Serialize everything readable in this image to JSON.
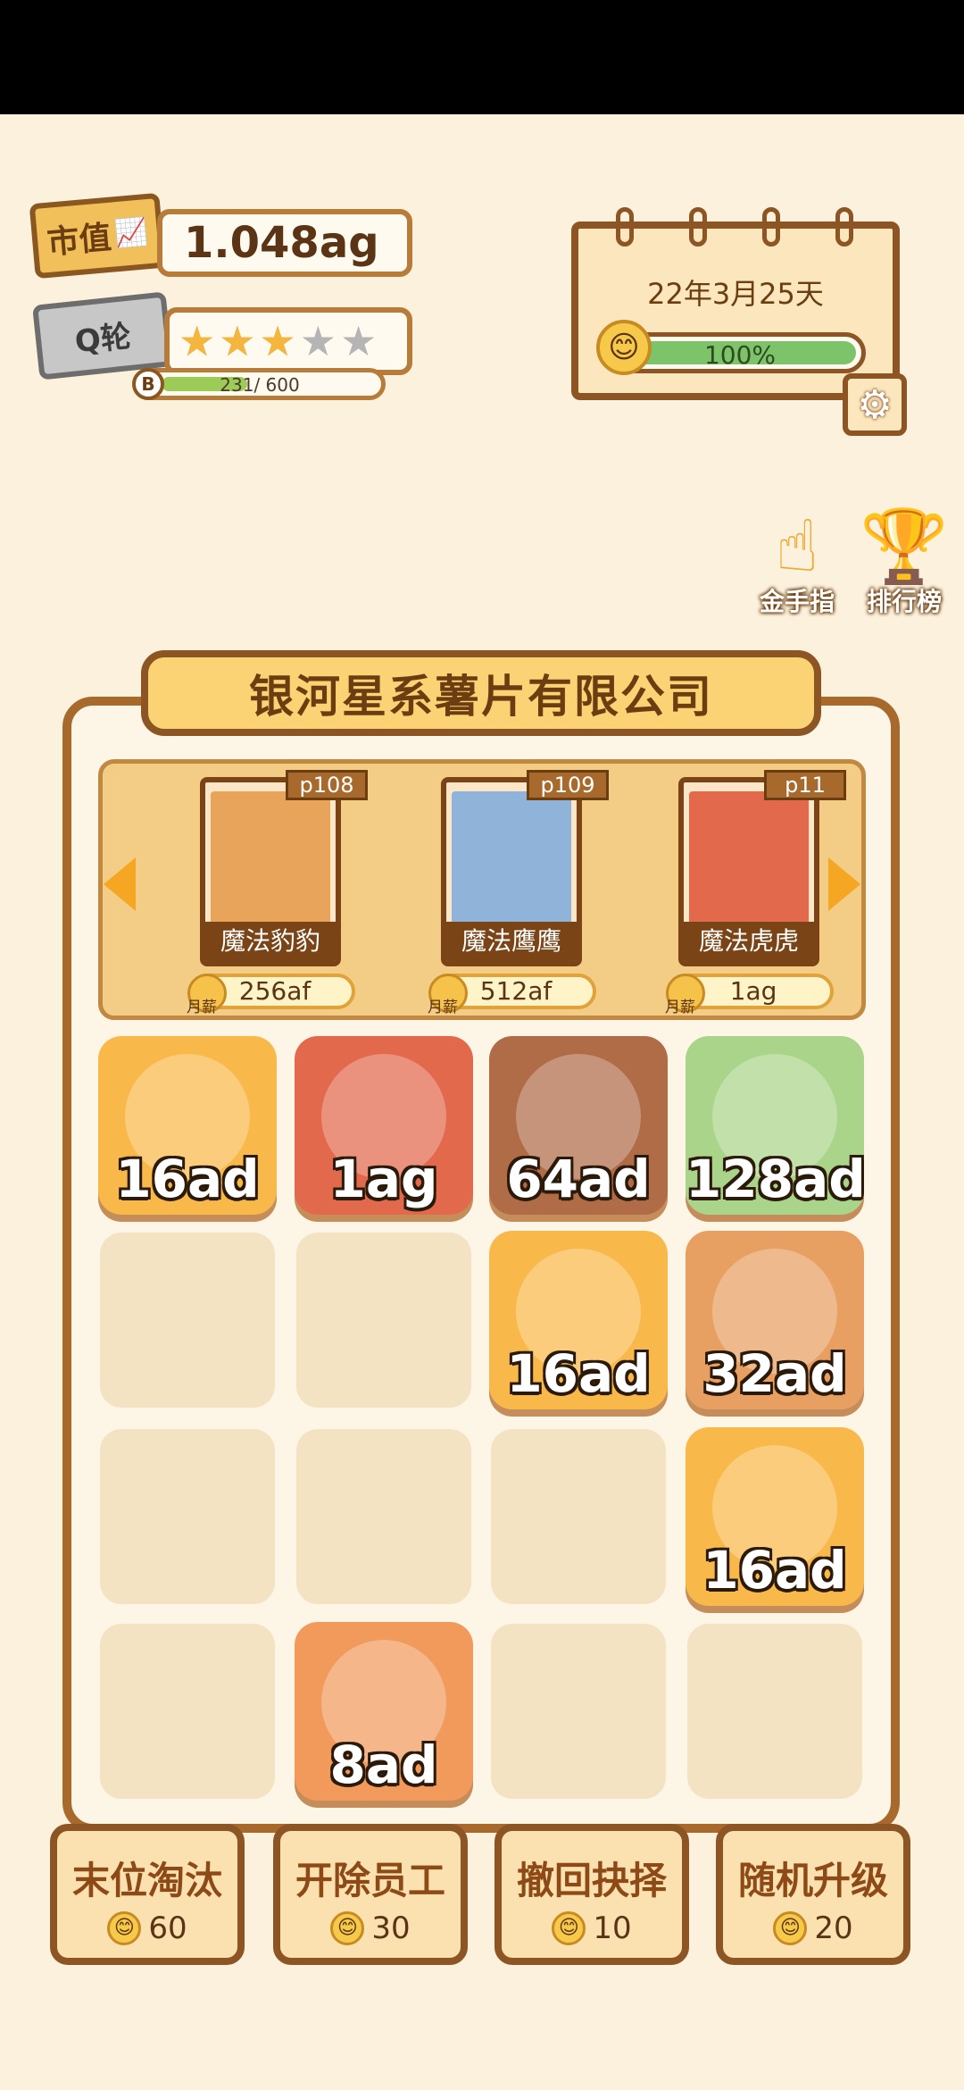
{
  "stats": {
    "market_cap_label": "市值",
    "market_cap_value": "1.048ag",
    "round_label": "Q轮",
    "stars_on": 3,
    "stars_total": 5,
    "xp_badge": "B",
    "xp_text": "231/ 600",
    "xp_fraction": 0.385
  },
  "calendar": {
    "date": "22年3月25天",
    "mood_percent_text": "100%",
    "mood_percent": 1.0
  },
  "side_buttons": {
    "golden_finger": "金手指",
    "leaderboard": "排行榜"
  },
  "company_name": "银河星系薯片有限公司",
  "hire_cards": [
    {
      "tag": "p108",
      "name": "魔法豹豹",
      "price": "256af",
      "monthly": "月薪",
      "color": "#e9a45c"
    },
    {
      "tag": "p109",
      "name": "魔法鹰鹰",
      "price": "512af",
      "monthly": "月薪",
      "color": "#8fb3d9"
    },
    {
      "tag": "p11",
      "name": "魔法虎虎",
      "price": "1ag",
      "monthly": "月薪",
      "color": "#e2694b"
    }
  ],
  "grid_tiles": [
    {
      "row": 0,
      "col": 0,
      "value": "16ad",
      "animal": "cat",
      "color": "#f8b94a"
    },
    {
      "row": 0,
      "col": 1,
      "value": "1ag",
      "animal": "tiger",
      "color": "#e2694b"
    },
    {
      "row": 0,
      "col": 2,
      "value": "64ad",
      "animal": "bear",
      "color": "#b06b47"
    },
    {
      "row": 0,
      "col": 3,
      "value": "128ad",
      "animal": "wolf",
      "color": "#a9d48a"
    },
    {
      "row": 1,
      "col": 2,
      "value": "16ad",
      "animal": "cat",
      "color": "#f8b94a"
    },
    {
      "row": 1,
      "col": 3,
      "value": "32ad",
      "animal": "shiba",
      "color": "#e8a062"
    },
    {
      "row": 2,
      "col": 3,
      "value": "16ad",
      "animal": "cat",
      "color": "#f8b94a"
    },
    {
      "row": 3,
      "col": 1,
      "value": "8ad",
      "animal": "red-panda",
      "color": "#f29a5c"
    }
  ],
  "actions": [
    {
      "label": "末位淘汰",
      "cost": "60"
    },
    {
      "label": "开除员工",
      "cost": "30"
    },
    {
      "label": "撤回抉择",
      "cost": "10"
    },
    {
      "label": "随机升级",
      "cost": "20"
    }
  ]
}
